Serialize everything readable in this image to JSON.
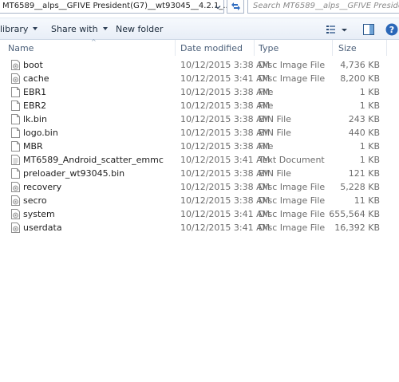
{
  "address": {
    "path": "MT6589__alps__GFIVE President(G7)__wt93045__4.2.1_...",
    "search_placeholder": "Search MT6589__alps__GFIVE Presiden..."
  },
  "toolbar": {
    "library_label": "library",
    "share_label": "Share with",
    "new_folder_label": "New folder"
  },
  "columns": {
    "name": "Name",
    "date": "Date modified",
    "type": "Type",
    "size": "Size"
  },
  "files": [
    {
      "name": "boot",
      "date": "10/12/2015 3:38 AM",
      "type": "Disc Image File",
      "size": "4,736 KB",
      "icon": "disc-image-icon"
    },
    {
      "name": "cache",
      "date": "10/12/2015 3:41 AM",
      "type": "Disc Image File",
      "size": "8,200 KB",
      "icon": "disc-image-icon"
    },
    {
      "name": "EBR1",
      "date": "10/12/2015 3:38 AM",
      "type": "File",
      "size": "1 KB",
      "icon": "file-icon"
    },
    {
      "name": "EBR2",
      "date": "10/12/2015 3:38 AM",
      "type": "File",
      "size": "1 KB",
      "icon": "file-icon"
    },
    {
      "name": "lk.bin",
      "date": "10/12/2015 3:38 AM",
      "type": "BIN File",
      "size": "243 KB",
      "icon": "file-icon"
    },
    {
      "name": "logo.bin",
      "date": "10/12/2015 3:38 AM",
      "type": "BIN File",
      "size": "440 KB",
      "icon": "file-icon"
    },
    {
      "name": "MBR",
      "date": "10/12/2015 3:38 AM",
      "type": "File",
      "size": "1 KB",
      "icon": "file-icon"
    },
    {
      "name": "MT6589_Android_scatter_emmc",
      "date": "10/12/2015 3:41 AM",
      "type": "Text Document",
      "size": "1 KB",
      "icon": "text-document-icon"
    },
    {
      "name": "preloader_wt93045.bin",
      "date": "10/12/2015 3:38 AM",
      "type": "BIN File",
      "size": "121 KB",
      "icon": "file-icon"
    },
    {
      "name": "recovery",
      "date": "10/12/2015 3:38 AM",
      "type": "Disc Image File",
      "size": "5,228 KB",
      "icon": "disc-image-icon"
    },
    {
      "name": "secro",
      "date": "10/12/2015 3:38 AM",
      "type": "Disc Image File",
      "size": "11 KB",
      "icon": "disc-image-icon"
    },
    {
      "name": "system",
      "date": "10/12/2015 3:41 AM",
      "type": "Disc Image File",
      "size": "655,564 KB",
      "icon": "disc-image-icon"
    },
    {
      "name": "userdata",
      "date": "10/12/2015 3:41 AM",
      "type": "Disc Image File",
      "size": "16,392 KB",
      "icon": "disc-image-icon"
    }
  ]
}
